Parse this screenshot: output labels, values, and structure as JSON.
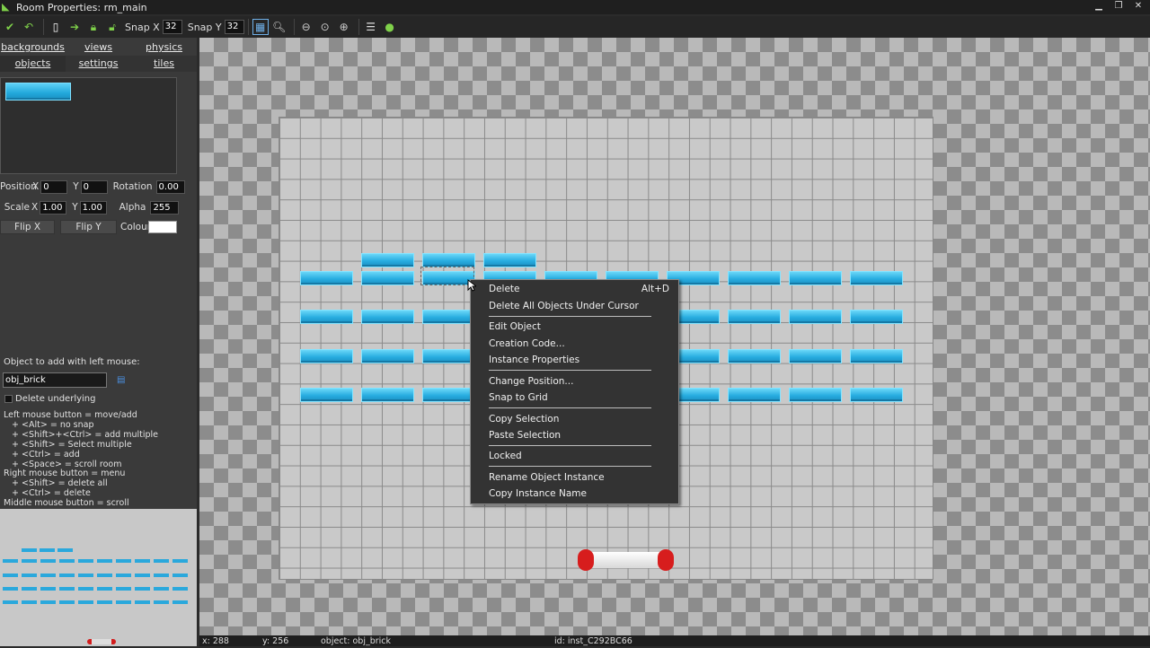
{
  "window": {
    "title": "Room Properties: rm_main",
    "buttons": [
      "minimize-icon",
      "restore-icon",
      "close-icon"
    ]
  },
  "toolbar": {
    "snap_x_label": "Snap X",
    "snap_x_value": "32",
    "snap_y_label": "Snap Y",
    "snap_y_value": "32"
  },
  "tabs": {
    "row1": [
      "backgrounds",
      "views",
      "physics"
    ],
    "row2": [
      "objects",
      "settings",
      "tiles"
    ],
    "active": "objects"
  },
  "props": {
    "position_label": "Position",
    "x_label": "X",
    "y_label": "Y",
    "pos_x": "0",
    "pos_y": "0",
    "rotation_label": "Rotation",
    "rotation": "0.00",
    "scale_label": "Scale",
    "scale_x": "1.00",
    "scale_y": "1.00",
    "alpha_label": "Alpha",
    "alpha": "255",
    "flip_x": "Flip X",
    "flip_y": "Flip Y",
    "colour_label": "Colour",
    "colour": "#ffffff"
  },
  "object_add": {
    "label": "Object to add with left mouse:",
    "value": "obj_brick",
    "delete_underlying": "Delete underlying"
  },
  "help_text": "Left mouse button = move/add\n   + <Alt> = no snap\n   + <Shift>+<Ctrl> = add multiple\n   + <Shift> = Select multiple\n   + <Ctrl> = add\n   + <Space> = scroll room\nRight mouse button = menu\n   + <Shift> = delete all\n   + <Ctrl> = delete\nMiddle mouse button = scroll",
  "context_menu": {
    "items": [
      {
        "label": "Delete",
        "shortcut": "Alt+D"
      },
      {
        "label": "Delete All Objects Under Cursor"
      },
      {
        "label": "Edit Object"
      },
      {
        "label": "Creation Code..."
      },
      {
        "label": "Instance Properties"
      },
      {
        "label": "Change Position..."
      },
      {
        "label": "Snap to Grid"
      },
      {
        "label": "Copy Selection"
      },
      {
        "label": "Paste Selection"
      },
      {
        "label": "Locked"
      },
      {
        "label": "Rename Object Instance"
      },
      {
        "label": "Copy Instance Name"
      }
    ]
  },
  "status": {
    "x": "x: 288",
    "y": "y: 256",
    "object": "object: obj_brick",
    "id": "id: inst_C292BC66"
  },
  "colors": {
    "brick": "#28ade0",
    "paddle_cap": "#d71d1d",
    "accent_check": "#7fd14a"
  }
}
